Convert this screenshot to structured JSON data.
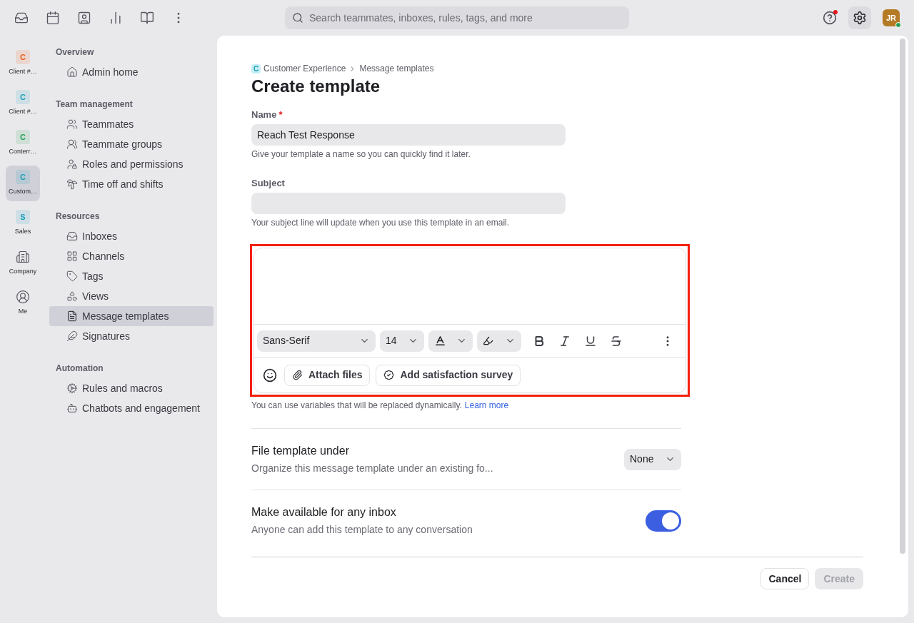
{
  "top_bar": {
    "search": {
      "placeholder": "Search teammates, inboxes, rules, tags, and more"
    },
    "help_notification": true,
    "avatar": {
      "initials": "JR",
      "online": true
    }
  },
  "workspaces": [
    {
      "kind": "letter",
      "initial": "C",
      "label": "Client #…",
      "color": "#f05a1a",
      "selected": false
    },
    {
      "kind": "letter",
      "initial": "C",
      "label": "Client #…",
      "color": "#1a9fb8",
      "selected": false
    },
    {
      "kind": "letter",
      "initial": "C",
      "label": "Conterr…",
      "color": "#22a052",
      "selected": false
    },
    {
      "kind": "letter",
      "initial": "C",
      "label": "Custom…",
      "color": "#1a9fb8",
      "selected": true
    },
    {
      "kind": "letter",
      "initial": "S",
      "label": "Sales",
      "color": "#1a9fb8",
      "selected": false
    },
    {
      "kind": "company",
      "label": "Company",
      "selected": false
    },
    {
      "kind": "me",
      "label": "Me",
      "selected": false
    }
  ],
  "nav": [
    {
      "title": "Overview",
      "items": [
        {
          "label": "Admin home",
          "selected": false
        }
      ]
    },
    {
      "title": "Team management",
      "items": [
        {
          "label": "Teammates",
          "selected": false
        },
        {
          "label": "Teammate groups",
          "selected": false
        },
        {
          "label": "Roles and permissions",
          "selected": false
        },
        {
          "label": "Time off and shifts",
          "selected": false
        }
      ]
    },
    {
      "title": "Resources",
      "items": [
        {
          "label": "Inboxes",
          "selected": false
        },
        {
          "label": "Channels",
          "selected": false
        },
        {
          "label": "Tags",
          "selected": false
        },
        {
          "label": "Views",
          "selected": false
        },
        {
          "label": "Message templates",
          "selected": true
        },
        {
          "label": "Signatures",
          "selected": false
        }
      ]
    },
    {
      "title": "Automation",
      "items": [
        {
          "label": "Rules and macros",
          "selected": false
        },
        {
          "label": "Chatbots and engagement",
          "selected": false
        }
      ]
    }
  ],
  "breadcrumb": {
    "badge": "C",
    "items": [
      "Customer Experience",
      "Message templates"
    ]
  },
  "title": "Create template",
  "fields": [
    {
      "label": "Name",
      "required_mark": "*",
      "value": "Reach Test Response",
      "hint": "Give your template a name so you can quickly find it later."
    },
    {
      "label": "Subject",
      "hint": "Your subject line will update when you use this template in an email."
    }
  ],
  "editor": {
    "font": "Sans-Serif",
    "size": "14",
    "buttons": [
      "Attach files",
      "Add satisfaction survey"
    ],
    "hint": "You can use variables that will be replaced dynamically.",
    "link": "Learn more"
  },
  "settings": [
    {
      "kind": "select",
      "title": "File template under",
      "description": "Organize this message template under an existing fo...",
      "value": "None"
    },
    {
      "kind": "toggle",
      "title": "Make available for any inbox",
      "description": "Anyone can add this template to any conversation",
      "on": true
    }
  ],
  "footer": {
    "cancel": "Cancel",
    "create": "Create",
    "create_disabled": true
  }
}
